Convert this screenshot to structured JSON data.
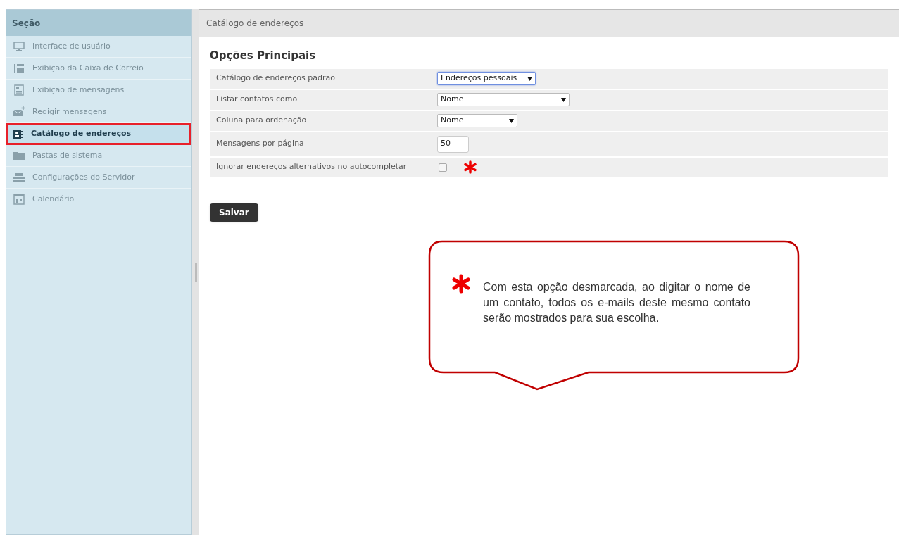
{
  "sidebar": {
    "title": "Seção",
    "items": [
      {
        "label": "Interface de usuário",
        "kind": "monitor",
        "selected": false
      },
      {
        "label": "Exibição da Caixa de Correio",
        "kind": "list",
        "selected": false
      },
      {
        "label": "Exibição de mensagens",
        "kind": "document",
        "selected": false
      },
      {
        "label": "Redigir mensagens",
        "kind": "envelope",
        "selected": false
      },
      {
        "label": "Catálogo de endereços",
        "kind": "contact",
        "selected": true
      },
      {
        "label": "Pastas de sistema",
        "kind": "folder",
        "selected": false
      },
      {
        "label": "Configurações do Servidor",
        "kind": "server",
        "selected": false
      },
      {
        "label": "Calendário",
        "kind": "calendar",
        "selected": false
      }
    ]
  },
  "main": {
    "title": "Catálogo de endereços",
    "section_title": "Opções Principais",
    "options": [
      {
        "label": "Catálogo de endereços padrão",
        "kind": "select",
        "value": "Endereços pessoais",
        "focused": true
      },
      {
        "label": "Listar contatos como",
        "kind": "select",
        "value": "Nome",
        "focused": false
      },
      {
        "label": "Coluna para ordenação",
        "kind": "select",
        "value": "Nome",
        "focused": false
      },
      {
        "label": "Mensagens por página",
        "kind": "input",
        "value": "50"
      },
      {
        "label": "Ignorar endereços alternativos no autocompletar",
        "kind": "checkbox",
        "checked": false,
        "marked": true
      }
    ],
    "save_button": "Salvar"
  },
  "callout": {
    "text": "Com esta opção desmarcada, ao digitar o nome de um contato, todos os e-mails deste mesmo contato serão mostrados para sua escolha."
  }
}
